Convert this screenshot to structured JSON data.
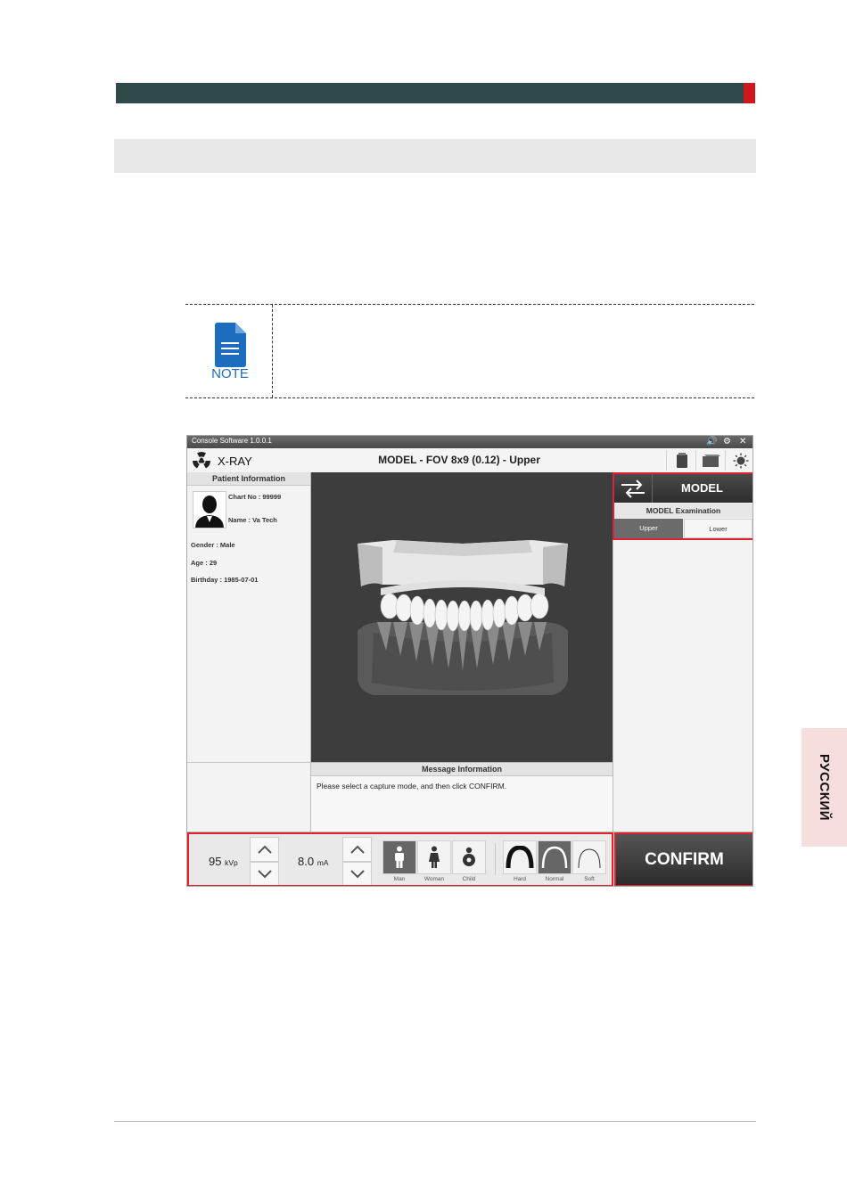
{
  "page": {
    "language_tab": "РУССКИЙ",
    "note_label": "NOTE"
  },
  "window": {
    "title": "Console Software  1.0.0.1",
    "app_name": "X-RAY",
    "mode_title": "MODEL - FOV 8x9 (0.12) - Upper",
    "icons": [
      "speaker-icon",
      "gear-icon",
      "close-icon",
      "radiation-icon",
      "storage-icon",
      "folder-icon",
      "sun-icon"
    ]
  },
  "patient": {
    "header": "Patient Information",
    "chart_no": "Chart No : 99999",
    "name": "Name : Va Tech",
    "gender": "Gender : Male",
    "age": "Age : 29",
    "birthday": "Birthday : 1985-07-01"
  },
  "message": {
    "header": "Message Information",
    "text": "Please select a capture mode, and then click CONFIRM."
  },
  "exam": {
    "model_label": "MODEL",
    "examination_label": "MODEL Examination",
    "options": [
      "Upper",
      "Lower"
    ],
    "selected": "Upper"
  },
  "exposure": {
    "kvp_value": "95",
    "kvp_unit": "kVp",
    "ma_value": "8.0",
    "ma_unit": "mA",
    "patient_types": [
      "Man",
      "Woman",
      "Child"
    ],
    "selected_patient_type": "Man",
    "arch_types": [
      "Hard",
      "Normal",
      "Soft"
    ],
    "selected_arch_type": "Normal"
  },
  "confirm_label": "CONFIRM"
}
